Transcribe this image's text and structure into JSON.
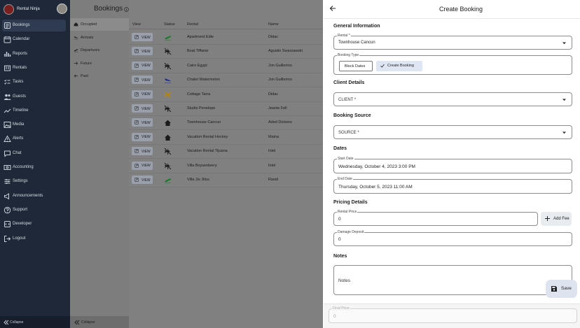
{
  "app": {
    "name": "Rental Ninja"
  },
  "nav": {
    "items": [
      {
        "label": "Bookings",
        "icon": "bookings-icon",
        "active": true
      },
      {
        "label": "Calendar",
        "icon": "calendar-icon"
      },
      {
        "label": "Reports",
        "icon": "reports-icon"
      },
      {
        "label": "Rentals",
        "icon": "rentals-icon"
      },
      {
        "label": "Tasks",
        "icon": "tasks-icon"
      },
      {
        "label": "Guests",
        "icon": "guests-icon"
      },
      {
        "label": "Timeline",
        "icon": "timeline-icon"
      },
      {
        "label": "Media",
        "icon": "media-icon"
      },
      {
        "label": "Alerts",
        "icon": "alerts-icon"
      },
      {
        "label": "Chat",
        "icon": "chat-icon"
      },
      {
        "label": "Accounting",
        "icon": "accounting-icon"
      },
      {
        "label": "Settings",
        "icon": "settings-icon"
      },
      {
        "label": "Announcements",
        "icon": "announcements-icon"
      },
      {
        "label": "Support",
        "icon": "support-icon"
      },
      {
        "label": "Developer",
        "icon": "developer-icon"
      },
      {
        "label": "Logout",
        "icon": "logout-icon"
      }
    ],
    "collapse": "Collapse"
  },
  "bookings": {
    "title": "Bookings",
    "filters": [
      {
        "label": "Occupied",
        "icon": "home-icon",
        "active": true
      },
      {
        "label": "Arrivals",
        "icon": "plane-arrival-icon"
      },
      {
        "label": "Departures",
        "icon": "plane-departure-icon"
      },
      {
        "label": "Future",
        "icon": "arrow-right-icon"
      },
      {
        "label": "Past",
        "icon": "arrow-left-icon"
      }
    ],
    "collapse": "Collapse",
    "columns": {
      "view": "View",
      "status": "Status",
      "rental": "Rental",
      "name": "Name"
    },
    "view_label": "VIEW",
    "rows": [
      {
        "status_icon": "plane-departure-icon",
        "status_color": "#1a7a2a",
        "rental": "Apartment Edie",
        "name": "Didac"
      },
      {
        "status_icon": "no-travel-icon",
        "status_color": "#1a1a1a",
        "rental": "Boat Tiffanie",
        "name": "Agustin Swarzawski"
      },
      {
        "status_icon": "no-travel-icon",
        "status_color": "#1a1a1a",
        "rental": "Cairo Egypt",
        "name": "Jon Guillermo"
      },
      {
        "status_icon": "plane-arrival-icon",
        "status_color": "#1d2e8c",
        "rental": "Chalet Watermelon",
        "name": "Jon Guillermo"
      },
      {
        "status_icon": "plane-swap-icon",
        "status_color": "#b8860b",
        "rental": "Cottage Tarra",
        "name": "Didac"
      },
      {
        "status_icon": "no-travel-icon",
        "status_color": "#1a1a1a",
        "rental": "Studio Penelope",
        "name": "Jeanie Fell"
      },
      {
        "status_icon": "house-icon",
        "status_color": "#1a1a1a",
        "rental": "Townhouse Cancun",
        "name": "Aded Dickens"
      },
      {
        "status_icon": "house-icon",
        "status_color": "#1a1a1a",
        "rental": "Vacation Rental Hockey",
        "name": "Maina"
      },
      {
        "status_icon": "no-travel-icon",
        "status_color": "#1a1a1a",
        "rental": "Vacation Rental Tijuana",
        "name": "Intel"
      },
      {
        "status_icon": "no-travel-icon",
        "status_color": "#1a1a1a",
        "rental": "Villa Boysenberry",
        "name": "Intel"
      },
      {
        "status_icon": "plane-departure-icon",
        "status_color": "#1a7a2a",
        "rental": "Villa Jiu Jitsu",
        "name": "Rasid"
      }
    ]
  },
  "drawer": {
    "title": "Create Booking",
    "general": {
      "heading": "General Information",
      "rental_label": "Rental *",
      "rental_value": "Townhouse Cancun",
      "booking_type_label": "Booking Type",
      "block_dates": "Block Dates",
      "create_booking": "Create Booking"
    },
    "client": {
      "heading": "Client Details",
      "placeholder": "CLIENT *"
    },
    "source": {
      "heading": "Booking Source",
      "placeholder": "SOURCE *"
    },
    "dates": {
      "heading": "Dates",
      "start_label": "Start Date",
      "start_value": "Wednesday, October 4, 2023 3:00 PM",
      "end_label": "End Date",
      "end_value": "Thursday, October 5, 2023 11:00 AM"
    },
    "pricing": {
      "heading": "Pricing Details",
      "rental_price_label": "Rental Price",
      "rental_price_value": "0",
      "add_fee": "Add Fee",
      "damage_deposit_label": "Damage Deposit",
      "damage_deposit_value": "0"
    },
    "notes": {
      "heading": "Notes",
      "placeholder": "Notes"
    },
    "final_price_label": "Final Price",
    "final_price_value": "0",
    "save": "Save"
  }
}
